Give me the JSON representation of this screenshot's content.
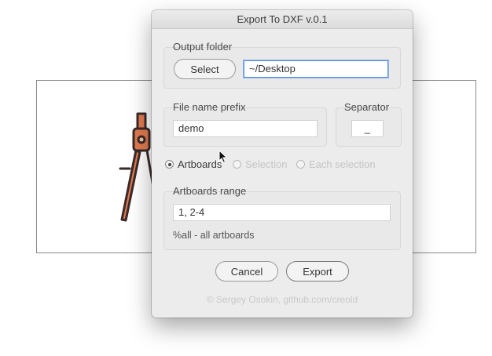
{
  "window": {
    "title": "Export To DXF v.0.1"
  },
  "output_folder": {
    "label": "Output folder",
    "select_label": "Select",
    "path_value": "~/Desktop"
  },
  "file_name": {
    "label": "File name prefix",
    "value": "demo"
  },
  "separator": {
    "label": "Separator",
    "value": "_"
  },
  "export_mode": {
    "options": [
      {
        "label": "Artboards",
        "checked": true,
        "enabled": true
      },
      {
        "label": "Selection",
        "checked": false,
        "enabled": false
      },
      {
        "label": "Each selection",
        "checked": false,
        "enabled": false
      }
    ]
  },
  "artboards_range": {
    "label": "Artboards range",
    "value": "1, 2-4",
    "hint": "%all - all artboards"
  },
  "buttons": {
    "cancel_label": "Cancel",
    "export_label": "Export"
  },
  "credit": "© Sergey Osokin, github.com/creold",
  "colors": {
    "focus_ring": "#5b8ed6",
    "compass_fill": "#e07a4f",
    "compass_outline": "#3a2a2a"
  },
  "icons": [
    "compass-drawing-icon",
    "mouse-cursor-icon"
  ]
}
